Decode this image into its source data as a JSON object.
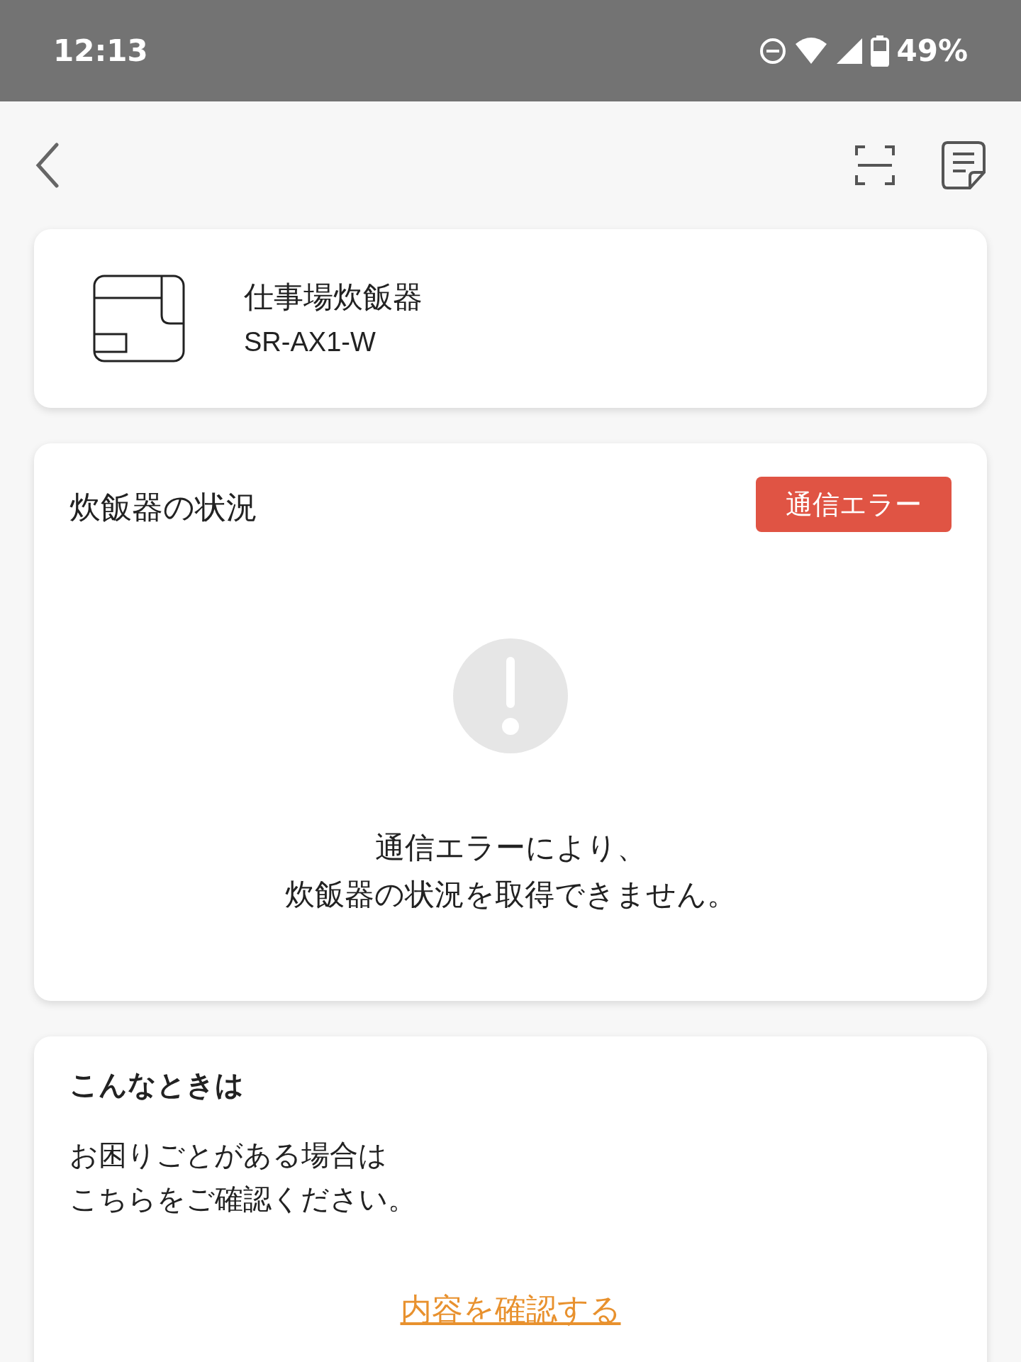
{
  "status_bar": {
    "time": "12:13",
    "battery": "49%"
  },
  "device": {
    "name": "仕事場炊飯器",
    "model": "SR-AX1-W"
  },
  "status_card": {
    "title": "炊飯器の状況",
    "badge": "通信エラー",
    "message_lines": [
      "通信エラーにより、",
      "炊飯器の状況を取得できません。"
    ]
  },
  "help_card": {
    "title": "こんなときは",
    "text_lines": [
      "お困りごとがある場合は",
      "こちらをご確認ください。"
    ],
    "link": "内容を確認する"
  }
}
